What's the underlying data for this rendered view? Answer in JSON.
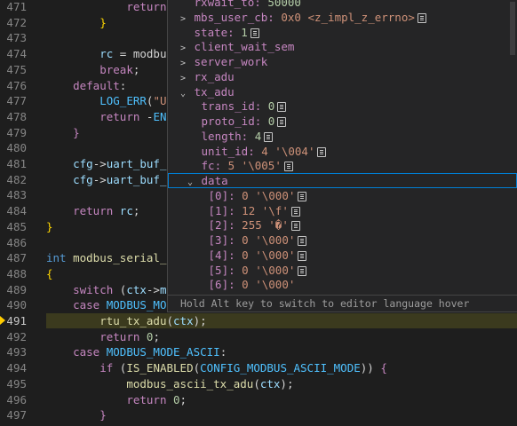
{
  "editor": {
    "lines": [
      {
        "n": "471",
        "tokens": [
          [
            "            ",
            ""
          ],
          [
            "return",
            "ctl"
          ]
        ]
      },
      {
        "n": "472",
        "tokens": [
          [
            "        ",
            ""
          ],
          [
            "}",
            "brace"
          ]
        ]
      },
      {
        "n": "473",
        "tokens": []
      },
      {
        "n": "474",
        "tokens": [
          [
            "        ",
            ""
          ],
          [
            "rc",
            "var"
          ],
          [
            " = ",
            ""
          ],
          [
            "modbus",
            ""
          ]
        ]
      },
      {
        "n": "475",
        "tokens": [
          [
            "        ",
            ""
          ],
          [
            "break",
            "ctl"
          ],
          [
            ";",
            ""
          ]
        ]
      },
      {
        "n": "476",
        "tokens": [
          [
            "    ",
            ""
          ],
          [
            "default",
            "ctl"
          ],
          [
            ":",
            ""
          ]
        ]
      },
      {
        "n": "477",
        "tokens": [
          [
            "        ",
            ""
          ],
          [
            "LOG_ERR",
            "mac"
          ],
          [
            "(",
            ""
          ],
          [
            "\"Un",
            "str"
          ]
        ]
      },
      {
        "n": "478",
        "tokens": [
          [
            "        ",
            ""
          ],
          [
            "return",
            "ctl"
          ],
          [
            " -",
            ""
          ],
          [
            "ENO",
            "mac"
          ]
        ]
      },
      {
        "n": "479",
        "tokens": [
          [
            "    ",
            ""
          ],
          [
            "}",
            "ctl"
          ]
        ]
      },
      {
        "n": "480",
        "tokens": []
      },
      {
        "n": "481",
        "tokens": [
          [
            "    ",
            ""
          ],
          [
            "cfg",
            "var"
          ],
          [
            "->",
            ""
          ],
          [
            "uart_buf_c",
            "var"
          ]
        ]
      },
      {
        "n": "482",
        "tokens": [
          [
            "    ",
            ""
          ],
          [
            "cfg",
            "var"
          ],
          [
            "->",
            ""
          ],
          [
            "uart_buf_p",
            "var"
          ]
        ]
      },
      {
        "n": "483",
        "tokens": []
      },
      {
        "n": "484",
        "tokens": [
          [
            "    ",
            ""
          ],
          [
            "return",
            "ctl"
          ],
          [
            " ",
            ""
          ],
          [
            "rc",
            "var"
          ],
          [
            ";",
            ""
          ]
        ]
      },
      {
        "n": "485",
        "tokens": [
          [
            "}",
            "brace"
          ]
        ]
      },
      {
        "n": "486",
        "tokens": []
      },
      {
        "n": "487",
        "tokens": [
          [
            "int",
            "kw"
          ],
          [
            " ",
            ""
          ],
          [
            "modbus_serial_t",
            "fn"
          ]
        ]
      },
      {
        "n": "488",
        "tokens": [
          [
            "{",
            "brace"
          ]
        ]
      },
      {
        "n": "489",
        "tokens": [
          [
            "    ",
            ""
          ],
          [
            "switch",
            "ctl"
          ],
          [
            " (",
            ""
          ],
          [
            "ctx",
            "var"
          ],
          [
            "->",
            ""
          ],
          [
            "mo",
            "var"
          ]
        ]
      },
      {
        "n": "490",
        "tokens": [
          [
            "    ",
            ""
          ],
          [
            "case",
            "ctl"
          ],
          [
            " ",
            ""
          ],
          [
            "MODBUS_MOD",
            "mac"
          ]
        ]
      },
      {
        "n": "491",
        "tokens": [
          [
            "        ",
            ""
          ],
          [
            "rtu_tx_adu",
            "fn"
          ],
          [
            "(",
            ""
          ],
          [
            "ctx",
            "var"
          ],
          [
            ");",
            ""
          ]
        ],
        "current": true
      },
      {
        "n": "492",
        "tokens": [
          [
            "        ",
            ""
          ],
          [
            "return",
            "ctl"
          ],
          [
            " ",
            ""
          ],
          [
            "0",
            "num"
          ],
          [
            ";",
            ""
          ]
        ]
      },
      {
        "n": "493",
        "tokens": [
          [
            "    ",
            ""
          ],
          [
            "case",
            "ctl"
          ],
          [
            " ",
            ""
          ],
          [
            "MODBUS_MODE_ASCII",
            "mac"
          ],
          [
            ":",
            ""
          ]
        ]
      },
      {
        "n": "494",
        "tokens": [
          [
            "        ",
            ""
          ],
          [
            "if",
            "ctl"
          ],
          [
            " (",
            ""
          ],
          [
            "IS_ENABLED",
            "fn"
          ],
          [
            "(",
            ""
          ],
          [
            "CONFIG_MODBUS_ASCII_MODE",
            "mac"
          ],
          [
            ")) ",
            ""
          ],
          [
            "{",
            "ctl"
          ]
        ]
      },
      {
        "n": "495",
        "tokens": [
          [
            "            ",
            ""
          ],
          [
            "modbus_ascii_tx_adu",
            "fn"
          ],
          [
            "(",
            ""
          ],
          [
            "ctx",
            "var"
          ],
          [
            ");",
            ""
          ]
        ]
      },
      {
        "n": "496",
        "tokens": [
          [
            "            ",
            ""
          ],
          [
            "return",
            "ctl"
          ],
          [
            " ",
            ""
          ],
          [
            "0",
            "num"
          ],
          [
            ";",
            ""
          ]
        ]
      },
      {
        "n": "497",
        "tokens": [
          [
            "        ",
            ""
          ],
          [
            "}",
            "ctl"
          ]
        ]
      }
    ]
  },
  "hover": {
    "rows": [
      {
        "indent": 1,
        "chevron": "",
        "name": "rxwait_to:",
        "value": " 50000",
        "vclass": "",
        "icon": false
      },
      {
        "indent": 1,
        "chevron": ">",
        "name": "mbs_user_cb:",
        "value": " 0x0 <z_impl_z_errno>",
        "vclass": "",
        "icon": true
      },
      {
        "indent": 1,
        "chevron": "",
        "name": "state:",
        "value": " 1",
        "vclass": "",
        "icon": true
      },
      {
        "indent": 1,
        "chevron": ">",
        "name": "client_wait_sem",
        "value": "",
        "vclass": "",
        "icon": false
      },
      {
        "indent": 1,
        "chevron": ">",
        "name": "server_work",
        "value": "",
        "vclass": "",
        "icon": false
      },
      {
        "indent": 1,
        "chevron": ">",
        "name": "rx_adu",
        "value": "",
        "vclass": "",
        "icon": false
      },
      {
        "indent": 1,
        "chevron": "⌄",
        "name": "tx_adu",
        "value": "",
        "vclass": "",
        "icon": false
      },
      {
        "indent": 2,
        "chevron": "",
        "name": "trans_id:",
        "value": " 0",
        "vclass": "",
        "icon": true
      },
      {
        "indent": 2,
        "chevron": "",
        "name": "proto_id:",
        "value": " 0",
        "vclass": "",
        "icon": true
      },
      {
        "indent": 2,
        "chevron": "",
        "name": "length:",
        "value": " 4",
        "vclass": "",
        "icon": true
      },
      {
        "indent": 2,
        "chevron": "",
        "name": "unit_id:",
        "value": " 4 '\\004'",
        "vclass": "",
        "icon": true
      },
      {
        "indent": 2,
        "chevron": "",
        "name": "fc:",
        "value": " 5 '\\005'",
        "vclass": "",
        "icon": true
      },
      {
        "indent": 2,
        "chevron": "⌄",
        "name": "data",
        "value": "",
        "vclass": "",
        "icon": false,
        "focused": true
      },
      {
        "indent": 3,
        "chevron": "",
        "name": "[0]:",
        "value": " 0 '\\000'",
        "vclass": "",
        "icon": true
      },
      {
        "indent": 3,
        "chevron": "",
        "name": "[1]:",
        "value": " 12 '\\f'",
        "vclass": "",
        "icon": true
      },
      {
        "indent": 3,
        "chevron": "",
        "name": "[2]:",
        "value": " 255 '�'",
        "vclass": "",
        "icon": true
      },
      {
        "indent": 3,
        "chevron": "",
        "name": "[3]:",
        "value": " 0 '\\000'",
        "vclass": "",
        "icon": true
      },
      {
        "indent": 3,
        "chevron": "",
        "name": "[4]:",
        "value": " 0 '\\000'",
        "vclass": "",
        "icon": true
      },
      {
        "indent": 3,
        "chevron": "",
        "name": "[5]:",
        "value": " 0 '\\000'",
        "vclass": "",
        "icon": true
      },
      {
        "indent": 3,
        "chevron": "",
        "name": "[6]:",
        "value": " 0 '\\000'",
        "vclass": "",
        "icon": false
      }
    ],
    "status": "Hold Alt key to switch to editor language hover"
  }
}
